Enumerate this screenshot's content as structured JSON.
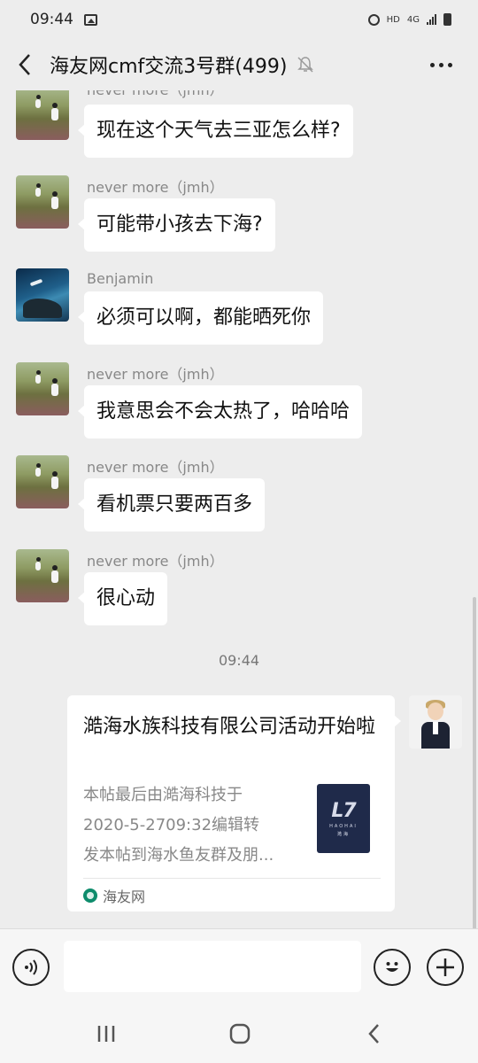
{
  "status_bar": {
    "time": "09:44",
    "network_label": "HD",
    "network_type": "4G"
  },
  "header": {
    "title": "海友网cmf交流3号群(499)",
    "back_icon": "chevron-left-icon",
    "mute_icon": "bell-off-icon",
    "more_icon": "more-dots-icon"
  },
  "messages": [
    {
      "sender": "never more（jmh）",
      "text": "现在这个天气去三亚怎么样?",
      "avatar": "field-photo"
    },
    {
      "sender": "never more（jmh）",
      "text": "可能带小孩去下海?",
      "avatar": "field-photo"
    },
    {
      "sender": "Benjamin",
      "text": "必须可以啊，都能晒死你",
      "avatar": "ocean-photo"
    },
    {
      "sender": "never more（jmh）",
      "text": "我意思会不会太热了，哈哈哈",
      "avatar": "field-photo"
    },
    {
      "sender": "never more（jmh）",
      "text": "看机票只要两百多",
      "avatar": "field-photo"
    },
    {
      "sender": "never more（jmh）",
      "text": "很心动",
      "avatar": "field-photo"
    }
  ],
  "time_separator": "09:44",
  "link_card": {
    "title": "澔海水族科技有限公司活动开始啦",
    "description_lines": [
      "本帖最后由澔海科技于",
      "2020-5-2709:32编辑转",
      "发本帖到海水鱼友群及朋..."
    ],
    "thumbnail_logo": "L7",
    "thumbnail_sub": "HAOHAI",
    "thumbnail_cn": "澔海",
    "source": "海友网"
  },
  "input_bar": {
    "placeholder": "",
    "voice_icon": "voice-icon",
    "emoji_icon": "emoji-icon",
    "plus_icon": "plus-icon"
  },
  "nav_bar": {
    "recents_icon": "recents-icon",
    "home_icon": "home-icon",
    "back_icon": "back-icon"
  },
  "colors": {
    "background": "#ededed",
    "bubble": "#ffffff",
    "source_icon": "#0e8c6c"
  }
}
